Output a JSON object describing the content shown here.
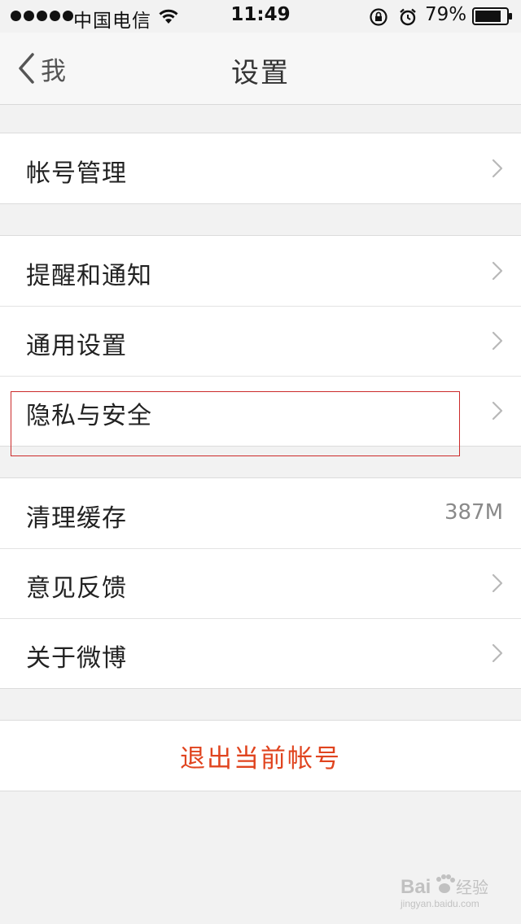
{
  "status_bar": {
    "carrier": "中国电信",
    "time": "11:49",
    "battery": "79%"
  },
  "nav": {
    "back_label": "我",
    "title": "设置"
  },
  "groups": [
    {
      "items": [
        {
          "label": "帐号管理",
          "icon": "chevron-right-icon"
        }
      ]
    },
    {
      "items": [
        {
          "label": "提醒和通知",
          "icon": "chevron-right-icon"
        },
        {
          "label": "通用设置",
          "icon": "chevron-right-icon"
        },
        {
          "label": "隐私与安全",
          "icon": "chevron-right-icon"
        }
      ]
    },
    {
      "items": [
        {
          "label": "清理缓存",
          "value": "387M"
        },
        {
          "label": "意见反馈",
          "icon": "chevron-right-icon"
        },
        {
          "label": "关于微博",
          "icon": "chevron-right-icon"
        }
      ]
    }
  ],
  "logout": {
    "label": "退出当前帐号"
  },
  "watermark": {
    "brand": "Bai",
    "brand_suffix": "经验",
    "url": "jingyan.baidu.com"
  },
  "colors": {
    "background": "#f2f2f2",
    "logout_red": "#e0441f",
    "highlight_red": "#cc2a2a",
    "secondary_text": "#8a8a8a"
  }
}
